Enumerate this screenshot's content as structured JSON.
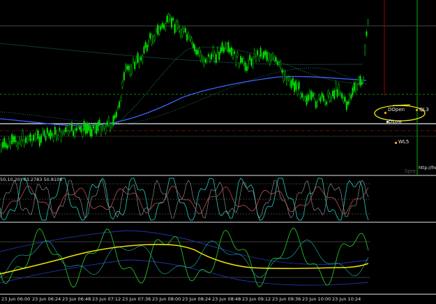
{
  "window": {
    "background": "#000000"
  },
  "main_panel": {
    "levels": {
      "dopen": "DOpen",
      "dlow": "DLow",
      "ql3": "QL3",
      "wl5": "WL5",
      "spread": "Spre",
      "url": "http://fre"
    },
    "colors": {
      "bull_candle": "#00e000",
      "ma_blue": "#3b64ff",
      "ma_dotted": "#2ba56a",
      "ma_faint": "#2a6a6a",
      "level_dashed": "#1fa31f",
      "level_red": "#b01010",
      "level_white": "#e8e8e8",
      "annotation": "#f2f200",
      "vline_red": "#a00000",
      "vline_green": "#00b000"
    }
  },
  "oscillator_panel": {
    "label": "50,10,20) 63.2783 50.8108",
    "colors": {
      "line_a": "#1fb8a8",
      "line_b": "#c05050",
      "line_c": "#a0a0a0"
    }
  },
  "lower_panel": {
    "colors": {
      "ma_yellow": "#f0e000",
      "line_green": "#20c020",
      "band_blue": "#2233aa"
    }
  },
  "time_axis": {
    "labels": [
      "23 Jun 06:00",
      "23 Jun 06:24",
      "23 Jun 06:48",
      "23 Jun 07:12",
      "23 Jun 07:36",
      "23 Jun 08:00",
      "23 Jun 08:24",
      "23 Jun 08:48",
      "23 Jun 09:12",
      "23 Jun 09:36",
      "23 Jun 10:00",
      "23 Jun 10:24"
    ]
  }
}
